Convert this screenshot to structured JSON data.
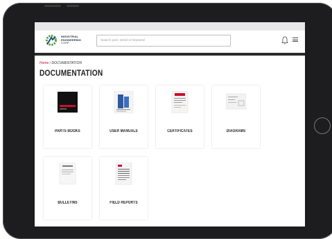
{
  "header": {
    "logo_line1": "INDUSTRIAL",
    "logo_line2": "ENGINEERING",
    "logo_line3": "CORP.",
    "search_placeholder": "Search part, serial or keyword"
  },
  "breadcrumb": {
    "home": "Home",
    "separator": " / ",
    "current": "DOCUMENTATION"
  },
  "page_title": "DOCUMENTATION",
  "cards": [
    {
      "label": "PARTS BOOKS"
    },
    {
      "label": "USER MANUALS"
    },
    {
      "label": "CERTIFICATES"
    },
    {
      "label": "DIAGRAMS"
    },
    {
      "label": "BULLETINS"
    },
    {
      "label": "FIELD REPORTS"
    }
  ],
  "colors": {
    "accent_red": "#c8102e",
    "logo_green": "#4a9a3a",
    "logo_blue": "#1f4e79",
    "bezel": "#1d1d1f"
  },
  "icons": [
    "gear-logo-icon",
    "bell-icon",
    "hamburger-menu-icon"
  ]
}
